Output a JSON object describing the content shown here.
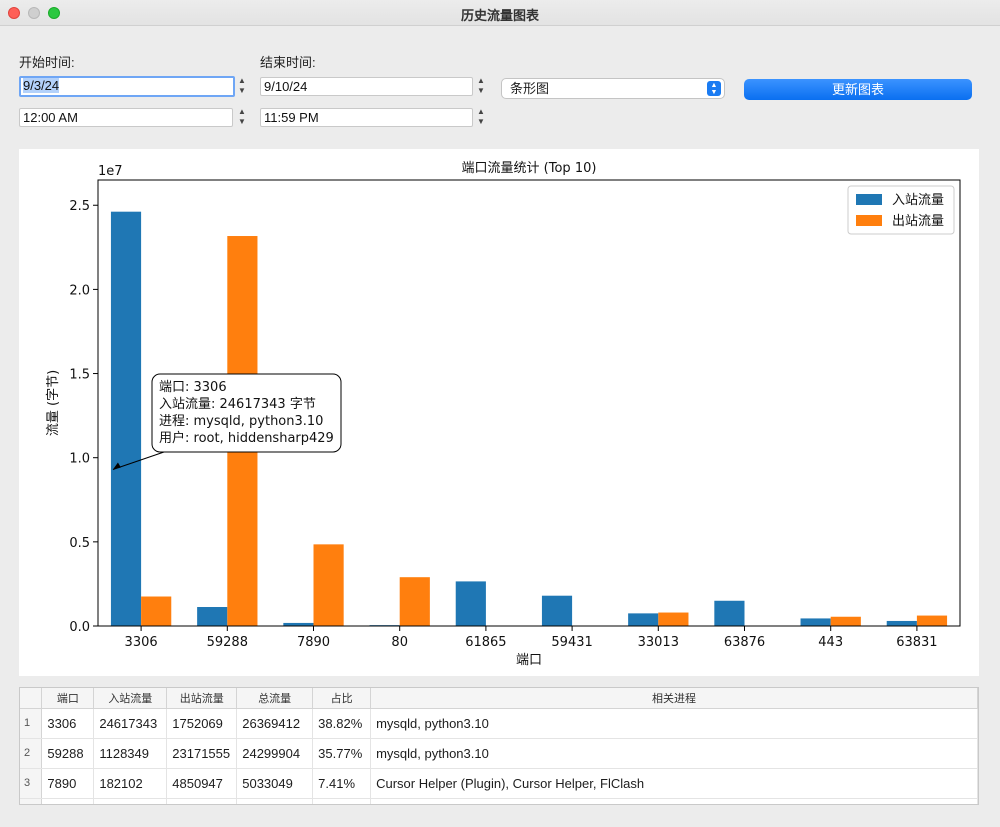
{
  "window": {
    "title": "历史流量图表"
  },
  "controls": {
    "start_label": "开始时间:",
    "start_date": "9/3/24",
    "start_time": "12:00 AM",
    "end_label": "结束时间:",
    "end_date": "9/10/24",
    "end_time": "11:59 PM",
    "chart_type": "条形图",
    "update_button": "更新图表"
  },
  "chart_data": {
    "type": "bar",
    "title": "端口流量统计 (Top 10)",
    "xlabel": "端口",
    "ylabel": "流量 (字节)",
    "y_exponent_label": "1e7",
    "categories": [
      "3306",
      "59288",
      "7890",
      "80",
      "61865",
      "59431",
      "33013",
      "63876",
      "443",
      "63831"
    ],
    "series": [
      {
        "name": "入站流量",
        "color": "#1f77b4",
        "values": [
          24617343,
          1128349,
          182102,
          50000,
          2650000,
          1800000,
          750000,
          1500000,
          450000,
          300000
        ]
      },
      {
        "name": "出站流量",
        "color": "#ff7f0e",
        "values": [
          1752069,
          23171555,
          4850947,
          2900000,
          0,
          0,
          800000,
          0,
          550000,
          620000
        ]
      }
    ],
    "ylim": [
      0,
      26500000
    ],
    "yticks": [
      "0.0",
      "0.5",
      "1.0",
      "1.5",
      "2.0",
      "2.5"
    ],
    "legend_position": "top-right",
    "annotation": {
      "lines": [
        "端口: 3306",
        "入站流量: 24617343 字节",
        "进程: mysqld, python3.10",
        "用户: root, hiddensharp429"
      ],
      "point": {
        "category": "3306",
        "value": 9300000
      }
    }
  },
  "table": {
    "headers": [
      "端口",
      "入站流量",
      "出站流量",
      "总流量",
      "占比",
      "相关进程"
    ],
    "rows": [
      {
        "num": "1",
        "cells": [
          "3306",
          "24617343",
          "1752069",
          "26369412",
          "38.82%",
          "mysqld, python3.10"
        ]
      },
      {
        "num": "2",
        "cells": [
          "59288",
          "1128349",
          "23171555",
          "24299904",
          "35.77%",
          "mysqld, python3.10"
        ]
      },
      {
        "num": "3",
        "cells": [
          "7890",
          "182102",
          "4850947",
          "5033049",
          "7.41%",
          "Cursor Helper (Plugin), Cursor Helper, FlClash"
        ]
      }
    ]
  }
}
